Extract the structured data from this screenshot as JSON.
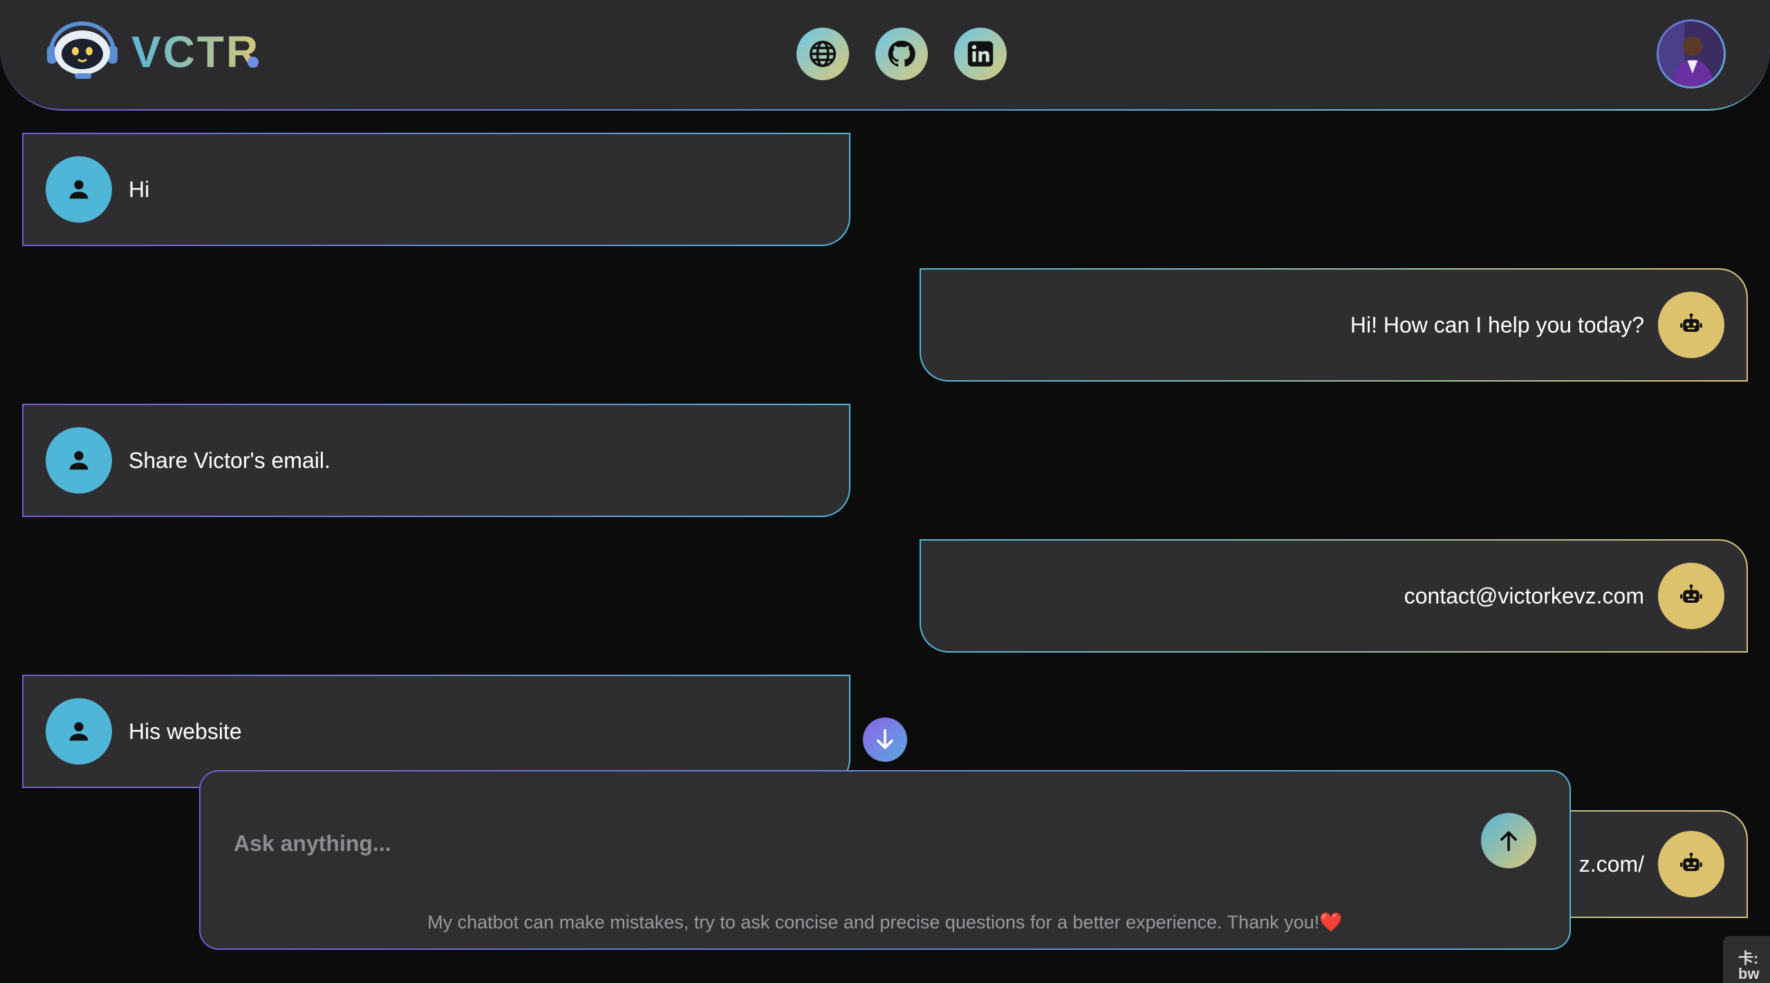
{
  "header": {
    "brand": "VCTR",
    "social": [
      {
        "name": "globe-icon"
      },
      {
        "name": "github-icon"
      },
      {
        "name": "linkedin-icon"
      }
    ]
  },
  "messages": [
    {
      "role": "user",
      "text": "Hi"
    },
    {
      "role": "bot",
      "text": "Hi! How can I help you today?"
    },
    {
      "role": "user",
      "text": "Share Victor's email."
    },
    {
      "role": "bot",
      "text": "contact@victorkevz.com"
    },
    {
      "role": "user",
      "text": "His website"
    },
    {
      "role": "bot",
      "text": "z.com/"
    }
  ],
  "composer": {
    "placeholder": "Ask anything...",
    "disclaimer": "My chatbot can make mistakes, try to ask concise and precise questions for a better experience. Thank you!❤️"
  },
  "corner_widget": {
    "text": "卡:\nbw"
  },
  "colors": {
    "background": "#0c0c0d",
    "panel": "#2e2e31",
    "user_badge": "#4fb6d8",
    "bot_badge": "#ddc26d",
    "accent_purple": "#7a5bd6",
    "accent_cyan": "#55b7d8",
    "accent_gold": "#d8c67a"
  }
}
